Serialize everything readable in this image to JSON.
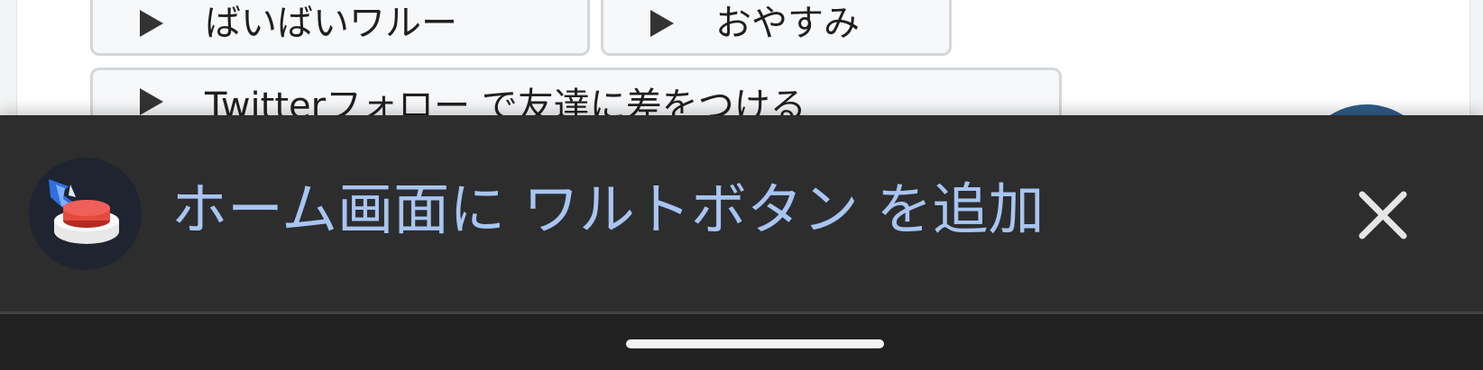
{
  "page": {
    "sound_buttons": [
      {
        "label": "ばいばいワルー"
      },
      {
        "label": "おやすみ"
      },
      {
        "label": "Twitterフォロー で友達に差をつける"
      }
    ]
  },
  "banner": {
    "app_icon": "red-push-button-icon",
    "message": "ホーム画面に ワルトボタン を追加",
    "close_icon": "close-icon",
    "text_color": "#a8c5f2",
    "background_color": "#2d2d2e"
  },
  "nav_bar": {
    "indicator": "home-indicator"
  }
}
